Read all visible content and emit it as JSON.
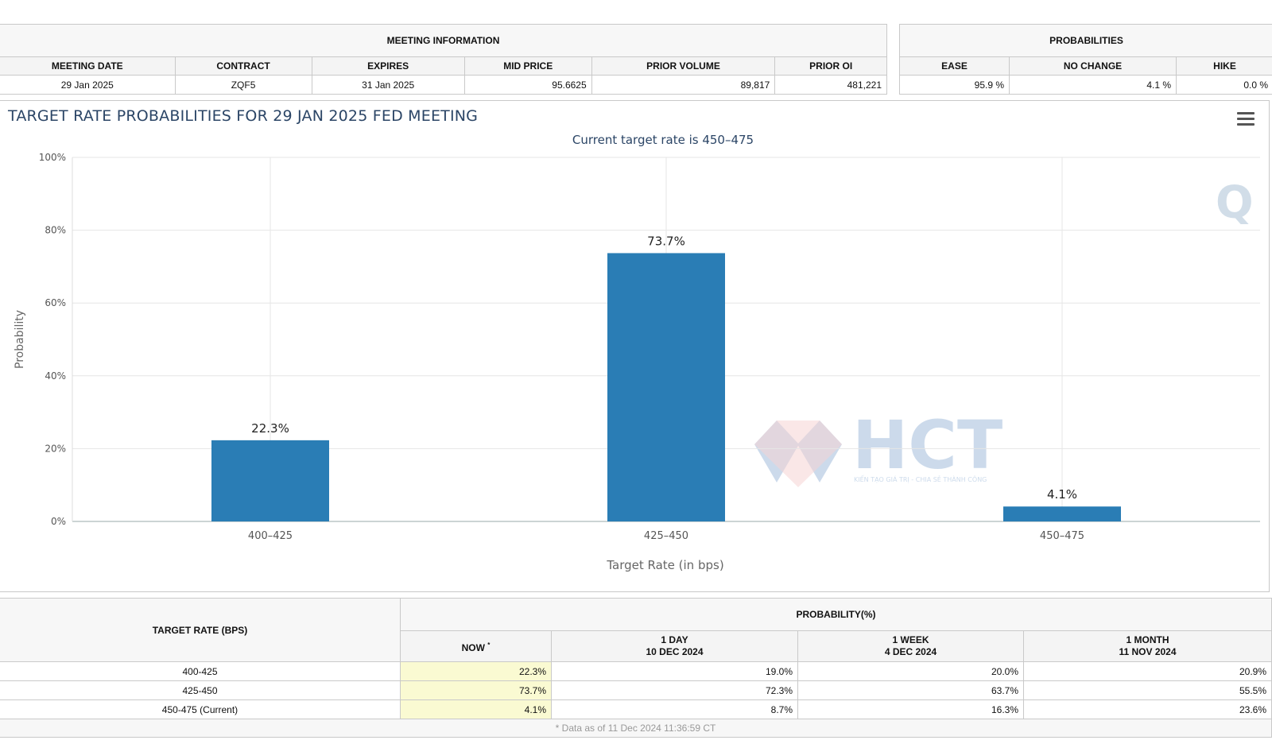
{
  "meeting_info": {
    "title": "MEETING INFORMATION",
    "headers": [
      "MEETING DATE",
      "CONTRACT",
      "EXPIRES",
      "MID PRICE",
      "PRIOR VOLUME",
      "PRIOR OI"
    ],
    "row": [
      "29 Jan 2025",
      "ZQF5",
      "31 Jan 2025",
      "95.6625",
      "89,817",
      "481,221"
    ]
  },
  "probabilities": {
    "title": "PROBABILITIES",
    "headers": [
      "EASE",
      "NO CHANGE",
      "HIKE"
    ],
    "row": [
      "95.9 %",
      "4.1 %",
      "0.0 %"
    ]
  },
  "chart": {
    "menu_icon": "hamburger-menu-icon",
    "watermark_logo_text": "HCT",
    "watermark_tagline": "KIẾN TẠO GIÁ TRỊ - CHIA SẺ THÀNH CÔNG",
    "watermark_corner_letter": "Q"
  },
  "chart_data": {
    "type": "bar",
    "title": "TARGET RATE PROBABILITIES FOR 29 JAN 2025 FED MEETING",
    "subtitle": "Current target rate is 450–475",
    "xlabel": "Target Rate (in bps)",
    "ylabel": "Probability",
    "categories": [
      "400–425",
      "425–450",
      "450–475"
    ],
    "values": [
      22.3,
      73.7,
      4.1
    ],
    "data_labels": [
      "22.3%",
      "73.7%",
      "4.1%"
    ],
    "ylim": [
      0,
      100
    ],
    "yticks": [
      0,
      20,
      40,
      60,
      80,
      100
    ],
    "ytick_labels": [
      "0%",
      "20%",
      "40%",
      "60%",
      "80%",
      "100%"
    ],
    "grid": true,
    "bar_color": "#2a7db5"
  },
  "bottom": {
    "target_header": "TARGET RATE (BPS)",
    "prob_header": "PROBABILITY(%)",
    "cols": [
      {
        "label": "NOW",
        "sub": ""
      },
      {
        "label": "1 DAY",
        "sub": "10 DEC 2024"
      },
      {
        "label": "1 WEEK",
        "sub": "4 DEC 2024"
      },
      {
        "label": "1 MONTH",
        "sub": "11 NOV 2024"
      }
    ],
    "now_marker": "*",
    "rows": [
      {
        "rate": "400-425",
        "vals": [
          "22.3%",
          "19.0%",
          "20.0%",
          "20.9%"
        ]
      },
      {
        "rate": "425-450",
        "vals": [
          "73.7%",
          "72.3%",
          "63.7%",
          "55.5%"
        ]
      },
      {
        "rate": "450-475 (Current)",
        "vals": [
          "4.1%",
          "8.7%",
          "16.3%",
          "23.6%"
        ]
      }
    ],
    "footnote": "* Data as of 11 Dec 2024 11:36:59 CT"
  }
}
